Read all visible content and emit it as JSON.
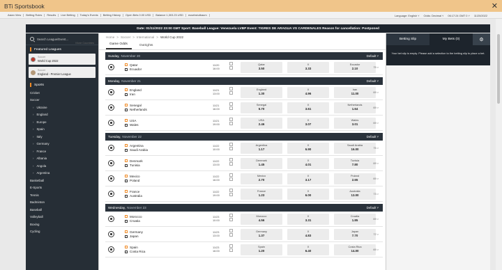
{
  "window": {
    "title": "BTi Sportsbook",
    "close": "✕"
  },
  "topnav": {
    "links": [
      "Asian View",
      "Betting Rules",
      "Results",
      "Live Betting",
      "Today's Events",
      "Betting History",
      "Open Bets 0.00 USD",
      "Balance 1,303.23 USD",
      "eusebstutbaum"
    ],
    "language": "Language: English ˅",
    "odds": "Odds: Decimal ˅",
    "time": "06:17:24 GMT 0 ˅",
    "date": "11/20/2022"
  },
  "banner": {
    "text": "Date: 01/11/2022 23:00 GMT Sport: Baseball League: Venezuela LVBP Event: TIGRES DE ARAGUA VS CARDENALES Reason for cancellation: Postponed"
  },
  "sidebar": {
    "search_placeholder": "Search League/Event...",
    "featured_title": "Featured Leagues",
    "featured": [
      {
        "sport": "Soccer",
        "name": "World Cup 2022"
      },
      {
        "sport": "Soccer",
        "name": "England - Premier League"
      }
    ],
    "sports_title": "Sports",
    "items": [
      {
        "label": "Cricket",
        "sub": false
      },
      {
        "label": "Soccer",
        "sub": false
      },
      {
        "label": "Ukraine",
        "sub": true
      },
      {
        "label": "England",
        "sub": true
      },
      {
        "label": "Europe",
        "sub": true
      },
      {
        "label": "Spain",
        "sub": true
      },
      {
        "label": "Italy",
        "sub": true
      },
      {
        "label": "Germany",
        "sub": true
      },
      {
        "label": "France",
        "sub": true
      },
      {
        "label": "Albania",
        "sub": true
      },
      {
        "label": "Angola",
        "sub": true
      },
      {
        "label": "Argentina",
        "sub": true
      },
      {
        "label": "More Countries",
        "sub": false,
        "more": true
      },
      {
        "label": "Basketball",
        "sub": false
      },
      {
        "label": "E-Sports",
        "sub": false
      },
      {
        "label": "Tennis",
        "sub": false
      },
      {
        "label": "Badminton",
        "sub": false
      },
      {
        "label": "Baseball",
        "sub": false
      },
      {
        "label": "Volleyball",
        "sub": false
      },
      {
        "label": "Boxing",
        "sub": false
      },
      {
        "label": "Cycling",
        "sub": false
      }
    ]
  },
  "main": {
    "breadcrumb": [
      "Home",
      "Soccer",
      "International",
      "World Cup 2022"
    ],
    "tabs": [
      "Game Odds",
      "Outrights"
    ],
    "default_label": "Default",
    "days": [
      {
        "name": "Sunday,",
        "date": "November 20",
        "events": [
          {
            "home": "Qatar",
            "away": "Ecuador",
            "date": "11/20",
            "time": "16:00",
            "o1_lbl": "Qatar",
            "o1": "3.50",
            "ox_lbl": "X",
            "ox": "3.33",
            "o2_lbl": "Ecuador",
            "o2": "2.10",
            "more": "75 >"
          }
        ]
      },
      {
        "name": "Monday,",
        "date": "November 21",
        "events": [
          {
            "home": "England",
            "away": "Iran",
            "date": "11/21",
            "time": "13:00",
            "o1_lbl": "England",
            "o1": "1.30",
            "ox_lbl": "X",
            "ox": "4.96",
            "o2_lbl": "Iran",
            "o2": "11.00",
            "more": "69 >"
          },
          {
            "home": "Senegal",
            "away": "Netherlands",
            "date": "11/21",
            "time": "16:00",
            "o1_lbl": "Senegal",
            "o1": "5.70",
            "ox_lbl": "X",
            "ox": "3.61",
            "o2_lbl": "Netherlands",
            "o2": "1.64",
            "more": "69 >"
          },
          {
            "home": "USA",
            "away": "Wales",
            "date": "11/21",
            "time": "19:00",
            "o1_lbl": "USA",
            "o1": "2.46",
            "ox_lbl": "X",
            "ox": "3.07",
            "o2_lbl": "Wales",
            "o2": "3.01",
            "more": "69 >"
          }
        ]
      },
      {
        "name": "Tuesday,",
        "date": "November 22",
        "events": [
          {
            "home": "Argentina",
            "away": "Saudi Arabia",
            "date": "11/22",
            "time": "10:00",
            "o1_lbl": "Argentina",
            "o1": "1.17",
            "ox_lbl": "X",
            "ox": "6.90",
            "o2_lbl": "Saudi Arabia",
            "o2": "16.00",
            "more": "75 >"
          },
          {
            "home": "Denmark",
            "away": "Tunisia",
            "date": "11/22",
            "time": "13:00",
            "o1_lbl": "Denmark",
            "o1": "1.45",
            "ox_lbl": "X",
            "ox": "4.01",
            "o2_lbl": "Tunisia",
            "o2": "7.80",
            "more": "69 >"
          },
          {
            "home": "Mexico",
            "away": "Poland",
            "date": "11/22",
            "time": "16:00",
            "o1_lbl": "Mexico",
            "o1": "2.70",
            "ox_lbl": "X",
            "ox": "3.17",
            "o2_lbl": "Poland",
            "o2": "2.65",
            "more": "69 >"
          },
          {
            "home": "France",
            "away": "Australia",
            "date": "11/22",
            "time": "19:00",
            "o1_lbl": "France",
            "o1": "1.23",
            "ox_lbl": "X",
            "ox": "6.00",
            "o2_lbl": "Australia",
            "o2": "13.00",
            "more": "73 >"
          }
        ]
      },
      {
        "name": "Wednesday,",
        "date": "November 23",
        "events": [
          {
            "home": "Morocco",
            "away": "Croatia",
            "date": "11/23",
            "time": "10:00",
            "o1_lbl": "Morocco",
            "o1": "4.56",
            "ox_lbl": "X",
            "ox": "3.31",
            "o2_lbl": "Croatia",
            "o2": "1.85",
            "more": "69 >"
          },
          {
            "home": "Germany",
            "away": "Japan",
            "date": "11/23",
            "time": "13:00",
            "o1_lbl": "Germany",
            "o1": "1.37",
            "ox_lbl": "X",
            "ox": "4.83",
            "o2_lbl": "Japan",
            "o2": "7.70",
            "more": "72 >"
          },
          {
            "home": "Spain",
            "away": "Costa Rica",
            "date": "11/23",
            "time": "16:00",
            "o1_lbl": "Spain",
            "o1": "1.20",
            "ox_lbl": "X",
            "ox": "6.40",
            "o2_lbl": "Costa Rica",
            "o2": "14.00",
            "more": "69 >"
          }
        ]
      }
    ]
  },
  "slip": {
    "tab_slip": "Betting Slip",
    "tab_bets": "My Bets (0)",
    "gear": "⚙",
    "message": "Your bet slip is empty. Please add a selection to the betting slip to place a bet."
  },
  "colors": {
    "accent": "#f08a24",
    "title_bar": "#f0c58a",
    "dark": "#262e36",
    "header": "#2a323b"
  }
}
